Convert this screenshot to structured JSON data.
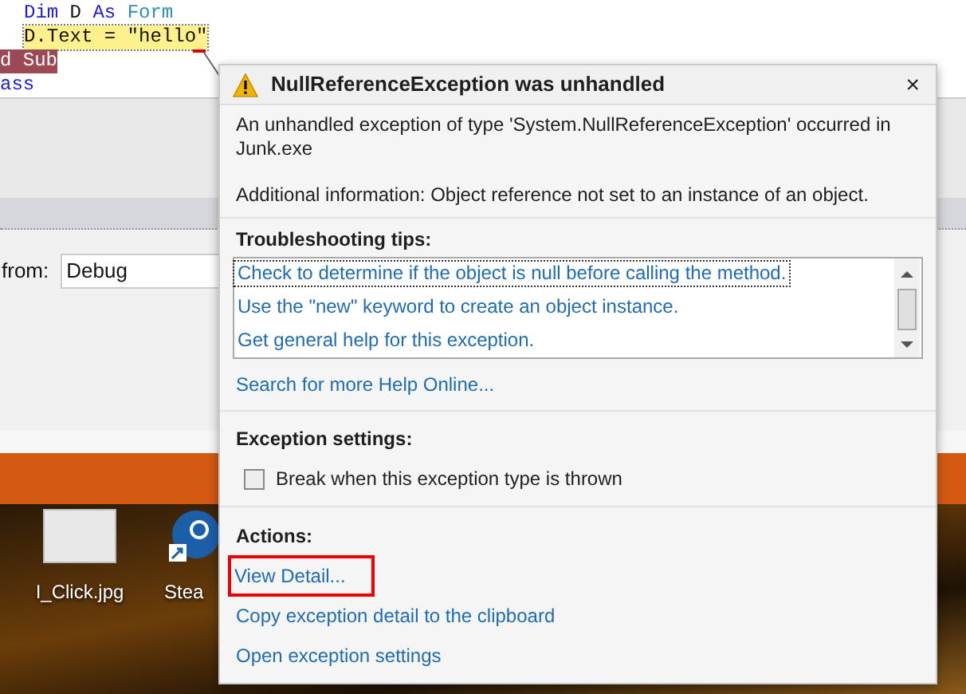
{
  "code_editor": {
    "lines": [
      {
        "kind": "normal",
        "tokens": [
          {
            "text": "Dim",
            "kind": "keyword"
          },
          {
            "text": " D ",
            "kind": "plain"
          },
          {
            "text": "As",
            "kind": "keyword"
          },
          {
            "text": " Form",
            "kind": "type"
          }
        ]
      },
      {
        "kind": "current",
        "tokens": [
          {
            "text": "D.Text = \"hello\"",
            "kind": "plain"
          }
        ]
      },
      {
        "kind": "breakpoint",
        "tokens": [
          {
            "text": "d Sub",
            "kind": "light"
          }
        ]
      },
      {
        "kind": "outdent",
        "tokens": [
          {
            "text": "ass",
            "kind": "keyword"
          }
        ]
      }
    ]
  },
  "output_panel": {
    "label": "from:",
    "value": "Debug"
  },
  "desktop": {
    "icons": [
      {
        "kind": "image",
        "label": "I_Click.jpg"
      },
      {
        "kind": "app",
        "label": "Stea"
      }
    ]
  },
  "dialog": {
    "title": "NullReferenceException was unhandled",
    "close": "×",
    "message": "An unhandled exception of type 'System.NullReferenceException' occurred in Junk.exe",
    "additional": "Additional information: Object reference not set to an instance of an object.",
    "tips_heading": "Troubleshooting tips:",
    "tips": [
      {
        "text": "Check to determine if the object is null before calling the method.",
        "selected": true
      },
      {
        "text": "Use the \"new\" keyword to create an object instance.",
        "selected": false
      },
      {
        "text": "Get general help for this exception.",
        "selected": false
      }
    ],
    "help_link": "Search for more Help Online...",
    "settings_heading": "Exception settings:",
    "break_option": {
      "label": "Break when this exception type is thrown",
      "checked": false
    },
    "actions_heading": "Actions:",
    "actions": [
      {
        "text": "View Detail...",
        "selected": true
      },
      {
        "text": "Copy exception detail to the clipboard",
        "selected": false
      },
      {
        "text": "Open exception settings",
        "selected": false
      }
    ]
  }
}
